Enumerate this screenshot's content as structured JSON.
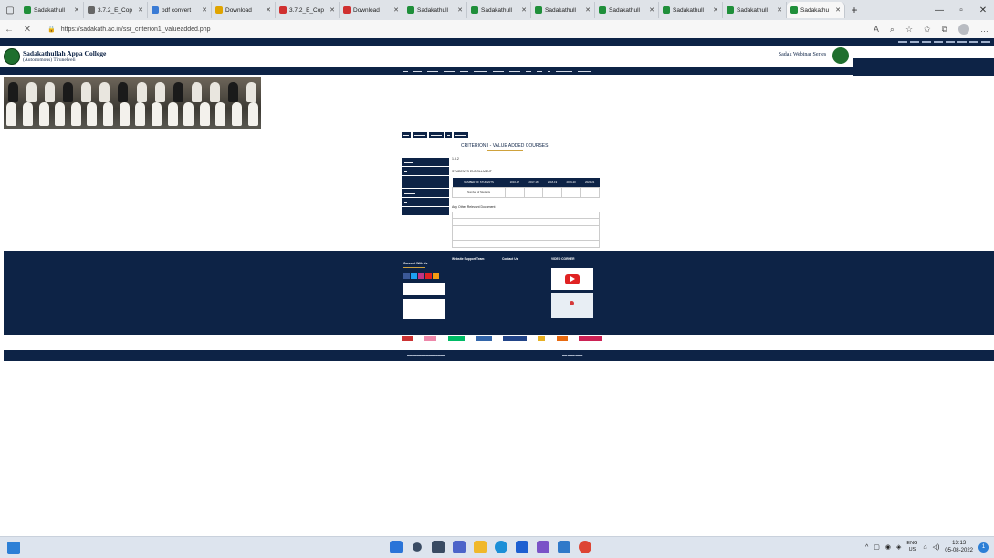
{
  "browser": {
    "tabs": [
      {
        "label": "Sadakathull",
        "color": "#1f8f3a"
      },
      {
        "label": "3.7.2_E_Cop",
        "color": "#666666"
      },
      {
        "label": "pdf convert",
        "color": "#3a7bd5"
      },
      {
        "label": "Download",
        "color": "#e0a400"
      },
      {
        "label": "3.7.2_E_Cop",
        "color": "#d03030"
      },
      {
        "label": "Download",
        "color": "#d03030"
      },
      {
        "label": "Sadakathull",
        "color": "#1f8f3a"
      },
      {
        "label": "Sadakathull",
        "color": "#1f8f3a"
      },
      {
        "label": "Sadakathull",
        "color": "#1f8f3a"
      },
      {
        "label": "Sadakathull",
        "color": "#1f8f3a"
      },
      {
        "label": "Sadakathull",
        "color": "#1f8f3a"
      },
      {
        "label": "Sadakathull",
        "color": "#1f8f3a"
      },
      {
        "label": "Sadakathu",
        "color": "#1f8f3a",
        "active": true
      }
    ],
    "url": "https://sadakath.ac.in/ssr_criterion1_valueadded.php"
  },
  "site": {
    "college_name": "Sadakathullah Appa College",
    "college_sub": "(Autonomous) Tirunelveli",
    "webinar_label": "Sadak Webinar Series",
    "criterion_title": "CRITERION I - VALUE ADDED COURSES",
    "content": {
      "intro": "1.3.2",
      "enrollment_label": "STUDENTS ENROLLMENT",
      "table_headers": [
        "NUMBER OF STUDENTS",
        "2016-17",
        "2017-18",
        "2018-19",
        "2019-20",
        "2020-21"
      ],
      "table_row": [
        "Number of Students",
        "",
        "",
        "",
        "",
        ""
      ],
      "docs_label": "Any Other Relevant Document",
      "docs": [
        "",
        "",
        "",
        "",
        ""
      ]
    },
    "footer": {
      "connect": "Connect With Us",
      "support": "Website Support Team",
      "contact": "Contact Us",
      "video": "VIDEO CORNER"
    }
  },
  "taskbar": {
    "lang": "ENG",
    "region": "US",
    "time": "13:13",
    "date": "05-08-2022",
    "notifications": "1"
  }
}
